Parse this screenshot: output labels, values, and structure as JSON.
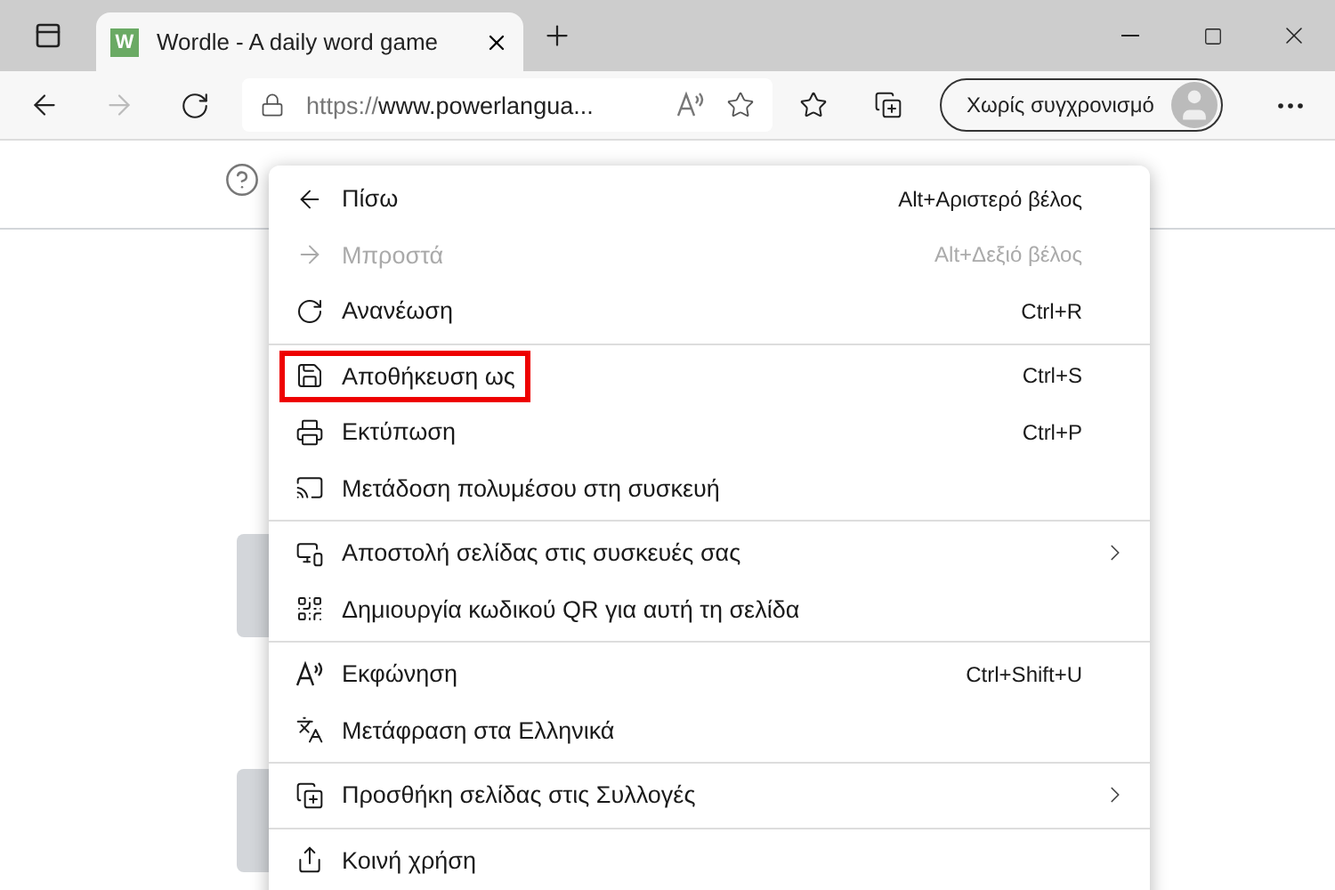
{
  "tab": {
    "favicon": "W",
    "title": "Wordle - A daily word game",
    "selected": true
  },
  "address": {
    "scheme": "https://",
    "host": "www.powerlangua..."
  },
  "profile": {
    "label": "Χωρίς συγχρονισμό"
  },
  "menu": {
    "sections": [
      [
        {
          "label": "Πίσω",
          "shortcut": "Alt+Αριστερό βέλος",
          "disabled": false,
          "submenu": false,
          "highlighted": false
        },
        {
          "label": "Μπροστά",
          "shortcut": "Alt+Δεξιό βέλος",
          "disabled": true,
          "submenu": false,
          "highlighted": false
        },
        {
          "label": "Ανανέωση",
          "shortcut": "Ctrl+R",
          "disabled": false,
          "submenu": false,
          "highlighted": false
        }
      ],
      [
        {
          "label": "Αποθήκευση ως",
          "shortcut": "Ctrl+S",
          "disabled": false,
          "submenu": false,
          "highlighted": true
        },
        {
          "label": "Εκτύπωση",
          "shortcut": "Ctrl+P",
          "disabled": false,
          "submenu": false,
          "highlighted": false
        },
        {
          "label": "Μετάδοση πολυμέσου στη συσκευή",
          "disabled": false,
          "submenu": false,
          "highlighted": false
        }
      ],
      [
        {
          "label": "Αποστολή σελίδας στις συσκευές σας",
          "disabled": false,
          "submenu": true,
          "highlighted": false
        },
        {
          "label": "Δημιουργία κωδικού QR για αυτή τη σελίδα",
          "disabled": false,
          "submenu": false,
          "highlighted": false
        }
      ],
      [
        {
          "label": "Εκφώνηση",
          "shortcut": "Ctrl+Shift+U",
          "disabled": false,
          "submenu": false,
          "highlighted": false
        },
        {
          "label": "Μετάφραση στα Ελληνικά",
          "disabled": false,
          "submenu": false,
          "highlighted": false
        }
      ],
      [
        {
          "label": "Προσθήκη σελίδας στις Συλλογές",
          "disabled": false,
          "submenu": true,
          "highlighted": false
        }
      ],
      [
        {
          "label": "Κοινή χρήση",
          "disabled": false,
          "submenu": false,
          "highlighted": false
        }
      ]
    ]
  }
}
